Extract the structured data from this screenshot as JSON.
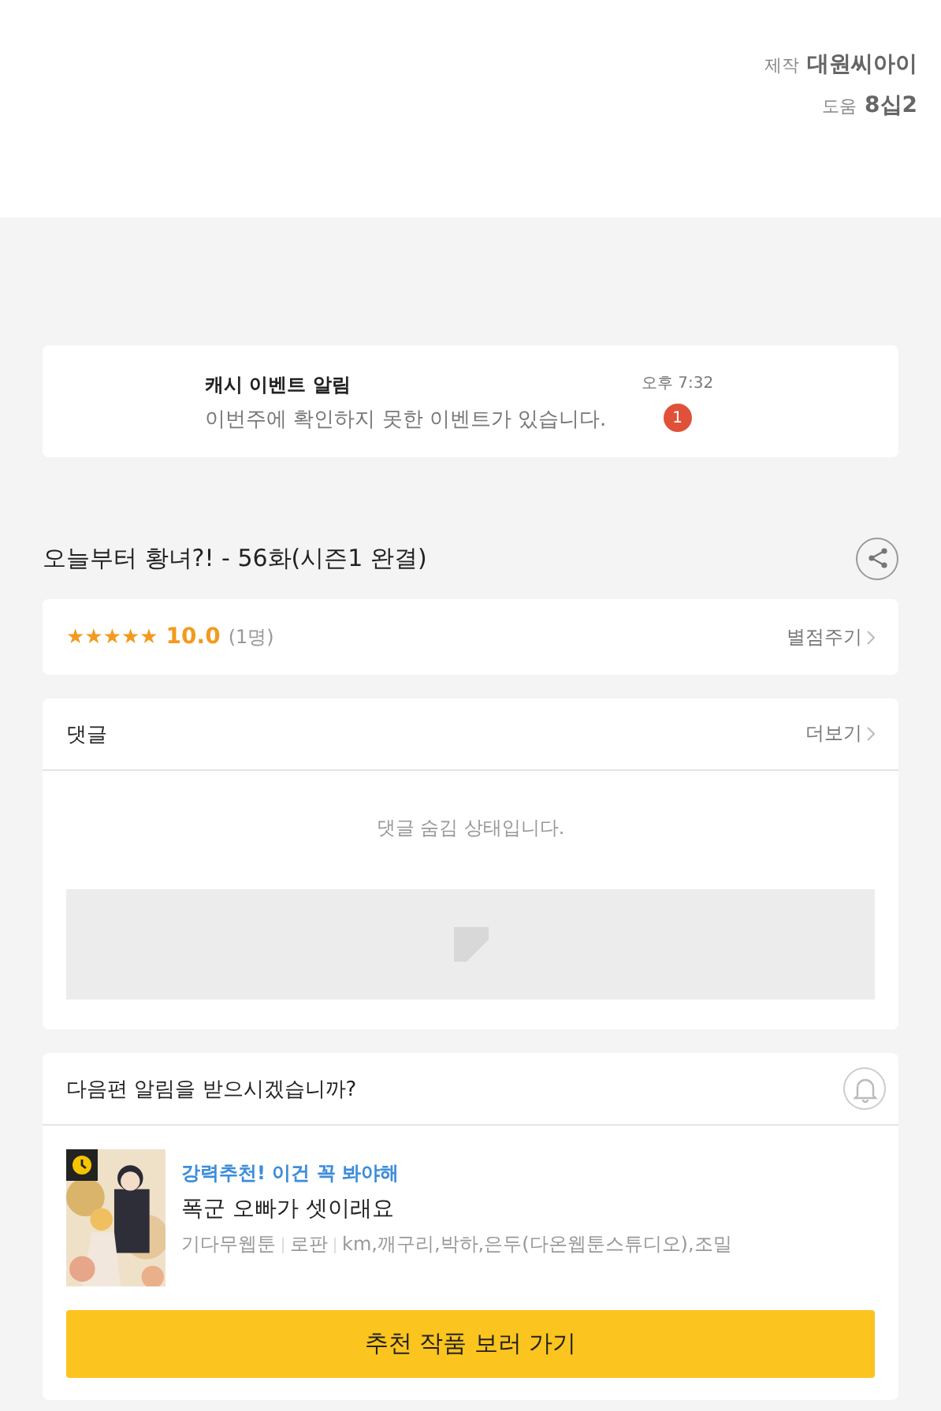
{
  "credits": [
    {
      "label": "제작",
      "value": "대원씨아이"
    },
    {
      "label": "도움",
      "value": "8십2"
    }
  ],
  "notice": {
    "title": "캐시 이벤트 알림",
    "message": "이번주에 확인하지 못한 이벤트가 있습니다.",
    "time": "오후 7:32",
    "badge": "1"
  },
  "episode": {
    "title": "오늘부터 황녀?! - 56화(시즌1 완결)"
  },
  "rating": {
    "stars": 5,
    "score": "10.0",
    "count": "(1명)",
    "action": "별점주기"
  },
  "comments": {
    "title": "댓글",
    "more": "더보기",
    "message": "댓글 숨김 상태입니다."
  },
  "next": {
    "question": "다음편 알림을 받으시겠습니까?",
    "tag": "강력추천! 이건 꼭 봐야해",
    "title": "폭군 오빠가 셋이래요",
    "meta": [
      "기다무웹툰",
      "로판",
      "km,깨구리,박하,은두(다온웹툰스튜디오),조밀"
    ],
    "button": "추천 작품 보러 가기"
  }
}
